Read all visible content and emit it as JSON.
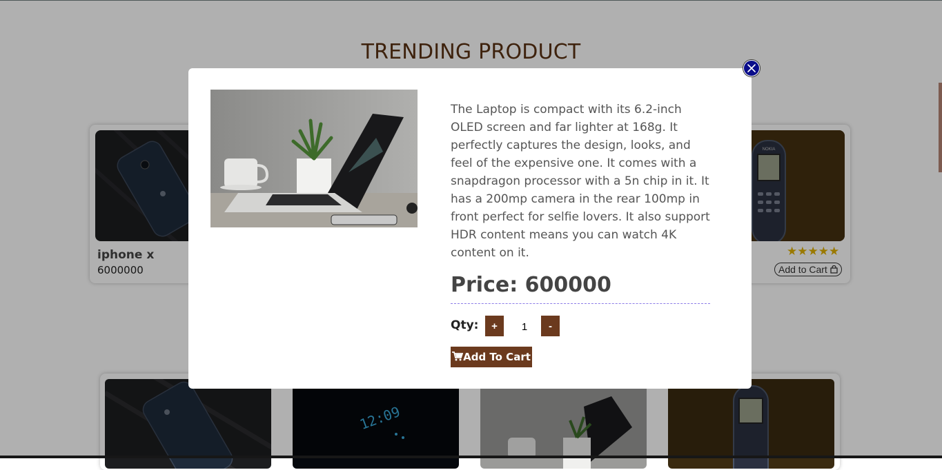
{
  "page": {
    "title": "TRENDING PRODUCT"
  },
  "cards_row1": [
    {
      "name": "iphone x",
      "price": "6000000"
    },
    {
      "stars": "★★★★★",
      "cart_label": "Add to Cart"
    }
  ],
  "modal": {
    "description": "The Laptop is compact with its 6.2-inch OLED screen and far lighter at 168g. It perfectly captures the design, looks, and feel of the expensive one. It comes with a snapdragon processor with a 5n chip in it. It has a 200mp camera in the rear 100mp in front perfect for selfie lovers. It also support HDR content means you can watch 4K content on it.",
    "price": "Price: 600000",
    "qty_label": "Qty:",
    "plus_label": "+",
    "qty_value": "1",
    "minus_label": "-",
    "cart_label": "Add To Cart"
  },
  "colors": {
    "accent": "#6b3a1e",
    "title": "#5a3214",
    "close": "#0a0d8a",
    "stars": "#e0b000"
  }
}
